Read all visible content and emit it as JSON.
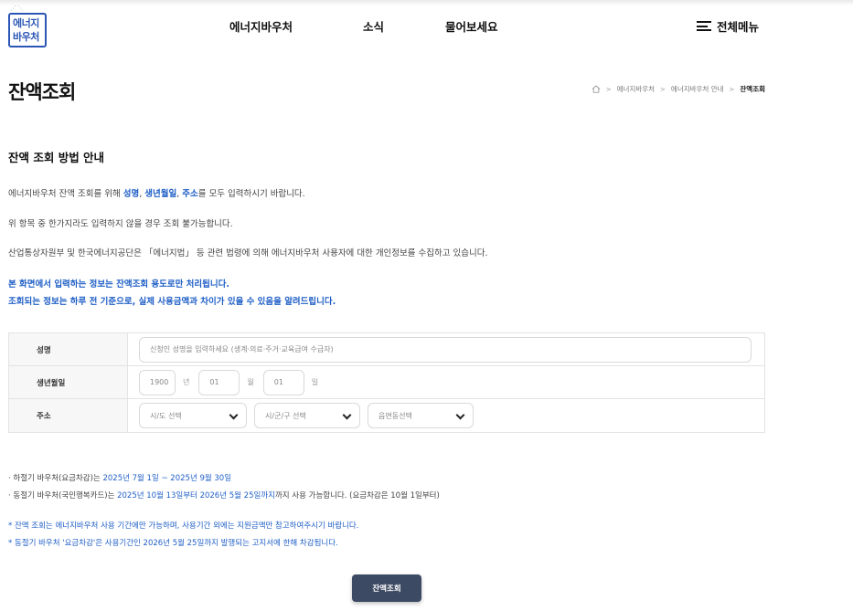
{
  "header": {
    "logo_line1": "에너지",
    "logo_line2": "바우처",
    "nav": [
      "에너지바우처",
      "소식",
      "물어보세요"
    ],
    "all_menu": "전체메뉴"
  },
  "page": {
    "title": "잔액조회",
    "breadcrumb": [
      "에너지바우처",
      "에너지바우처 안내",
      "잔액조회"
    ]
  },
  "guide": {
    "title": "잔액 조회 방법 안내",
    "p1_prefix": "에너지바우처 잔액 조회를 위해 ",
    "p1_hl1": "성명",
    "p1_hl2": "생년월일",
    "p1_hl3": "주소",
    "p1_suffix": "를 모두 입력하시기 바랍니다.",
    "p1_comma": ", ",
    "p2": "위 항목 중 한가지라도 입력하지 않을 경우 조회 불가능합니다.",
    "p3": "산업통상자원부 및 한국에너지공단은 「에너지법」 등 관련 법령에 의해 에너지바우처 사용자에 대한 개인정보를 수집하고 있습니다.",
    "notice1": "본 화면에서 입력하는 정보는 잔액조회 용도로만 처리됩니다.",
    "notice2": "조회되는 정보는 하루 전 기준으로, 실제 사용금액과 차이가 있을 수 있음을 알려드립니다."
  },
  "form": {
    "name_label": "성명",
    "name_placeholder": "신청인 성명을 입력하세요 (생계·의료·주거·교육급여 수급자)",
    "birth_label": "생년월일",
    "year_value": "1900",
    "year_unit": "년",
    "month_value": "01",
    "month_unit": "월",
    "day_value": "01",
    "day_unit": "일",
    "address_label": "주소",
    "sido_select": "시/도 선택",
    "sigungu_select": "시/군/구 선택",
    "eupmyeondong_select": "읍면동선택"
  },
  "notes": {
    "summer_prefix": "· 하절기 바우처(요금차감)는 ",
    "summer_period": "2025년 7월 1일 ~ 2025년 9월 30일",
    "winter_prefix": "· 동절기 바우처(국민행복카드)는 ",
    "winter_period": "2025년 10월 13일부터 2026년 5월 25일까지",
    "winter_suffix": "까지 사용 가능합니다. (요금차감은 10월 1일부터)",
    "star1": "* 잔액 조회는 에너지바우처 사용 기간에만 가능하며, 사용기간 외에는 지원금액만 참고하여주시기 바랍니다.",
    "star2": "* 동절기 바우처 '요금차감'은 사용기간인 2026년 5월 25일까지 발행되는 고지서에 한해 차감됩니다."
  },
  "submit_label": "잔액조회",
  "colors": {
    "accent": "#1f5fc6",
    "button": "#3d4a63",
    "logo": "#2b56b5"
  }
}
